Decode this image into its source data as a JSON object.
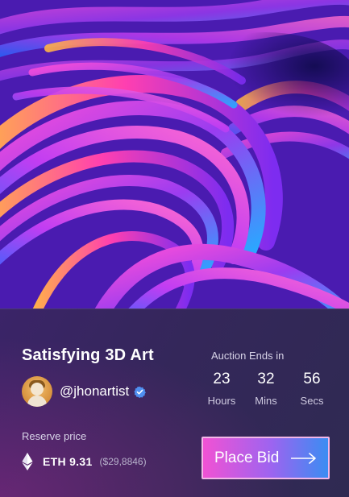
{
  "artwork": {
    "alt_icon": "abstract-3d-swirl-image"
  },
  "nft": {
    "title": "Satisfying 3D Art",
    "creator_handle": "@jhonartist",
    "verified_icon": "verified-badge-icon"
  },
  "auction": {
    "label": "Auction Ends in",
    "hours_value": "23",
    "hours_label": "Hours",
    "mins_value": "32",
    "mins_label": "Mins",
    "secs_value": "56",
    "secs_label": "Secs"
  },
  "reserve": {
    "label": "Reserve price",
    "currency_icon": "ethereum-icon",
    "amount": "ETH 9.31",
    "usd": "($29,8846)"
  },
  "actions": {
    "place_bid_label": "Place Bid",
    "arrow_icon": "arrow-right-icon"
  },
  "colors": {
    "panel_bg": "#34275a",
    "button_gradient_start": "#f152d4",
    "button_gradient_end": "#3a8df2",
    "verified": "#4f8ff0"
  }
}
